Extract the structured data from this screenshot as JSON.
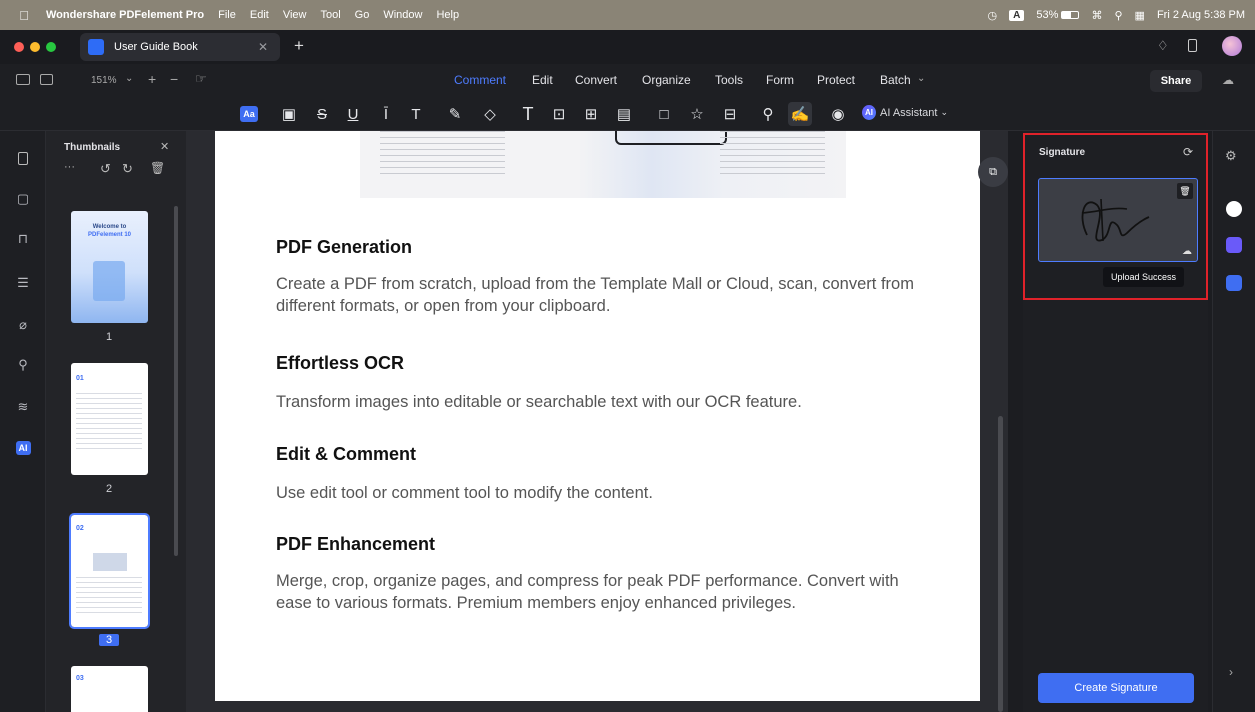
{
  "menubar": {
    "app_name": "Wondershare PDFelement Pro",
    "menus": [
      "File",
      "Edit",
      "View",
      "Tool",
      "Go",
      "Window",
      "Help"
    ],
    "battery": "53%",
    "datetime": "Fri 2 Aug  5:38 PM",
    "input_badge": "A"
  },
  "tabbar": {
    "doc_tab_label": "User Guide Book"
  },
  "toolbar": {
    "zoom": "151%",
    "menu_tabs": [
      "Comment",
      "Edit",
      "Convert",
      "Organize",
      "Tools",
      "Form",
      "Protect",
      "Batch"
    ],
    "active_tab": "Comment",
    "share_label": "Share",
    "ai_assistant_label": "AI Assistant",
    "ai_badge": "AI",
    "accent_color": "#4e7cff"
  },
  "thumbnails": {
    "title": "Thumbnails",
    "pages": [
      {
        "num": "1",
        "heading": "Welcome to",
        "subheading": "PDFelement 10"
      },
      {
        "num": "2",
        "heading": "01"
      },
      {
        "num": "3",
        "heading": "02"
      },
      {
        "num": "",
        "heading": "03"
      }
    ],
    "selected_page": "3"
  },
  "rail": {
    "ai_label": "AI"
  },
  "document": {
    "sections": [
      {
        "title": "PDF Generation",
        "body": "Create a PDF from scratch, upload from the Template Mall or Cloud, scan, convert from different formats, or open from your clipboard."
      },
      {
        "title": "Effortless OCR",
        "body": "Transform images into editable or searchable text with our OCR feature."
      },
      {
        "title": "Edit & Comment",
        "body": "Use edit tool or comment tool to modify the content."
      },
      {
        "title": "PDF Enhancement",
        "body": "Merge, crop, organize pages, and compress for peak PDF performance. Convert with ease to various formats. Premium members enjoy enhanced privileges."
      }
    ]
  },
  "signature_panel": {
    "title": "Signature",
    "tooltip": "Upload Success",
    "create_button": "Create Signature",
    "highlight_color": "#e0222a"
  }
}
